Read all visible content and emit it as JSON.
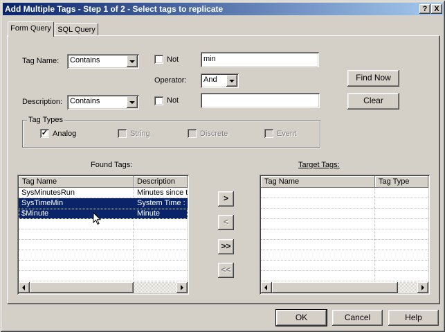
{
  "window": {
    "title": "Add Multiple Tags - Step 1 of 2 - Select tags to replicate",
    "help_label": "?",
    "close_label": "X"
  },
  "tabs": [
    {
      "label": "Form Query"
    },
    {
      "label": "SQL Query"
    }
  ],
  "form": {
    "tag_name_label": "Tag Name:",
    "tag_name_mode": "Contains",
    "not_label": "Not",
    "tag_name_value": "min",
    "operator_label": "Operator:",
    "operator_value": "And",
    "description_label": "Description:",
    "description_mode": "Contains",
    "description_value": "",
    "find_now_label": "Find Now",
    "clear_label": "Clear"
  },
  "tag_types": {
    "label": "Tag Types",
    "analog": {
      "label": "Analog",
      "checked": true
    },
    "string": {
      "label": "String",
      "checked": false
    },
    "discrete": {
      "label": "Discrete",
      "checked": false
    },
    "event": {
      "label": "Event",
      "checked": false
    },
    "check_mark": "✓"
  },
  "found_tags": {
    "label": "Found Tags:",
    "columns": [
      "Tag Name",
      "Description"
    ],
    "rows": [
      {
        "name": "SysMinutesRun",
        "desc": "Minutes since the",
        "selected": false
      },
      {
        "name": "SysTimeMin",
        "desc": "System Time : Min",
        "selected": true
      },
      {
        "name": "$Minute",
        "desc": "Minute",
        "selected": true
      }
    ]
  },
  "target_tags": {
    "label": "Target Tags:",
    "columns": [
      "Tag Name",
      "Tag Type"
    ],
    "rows": []
  },
  "move_buttons": {
    "add": ">",
    "remove": "<",
    "add_all": ">>",
    "remove_all": "<<"
  },
  "footer": {
    "ok": "OK",
    "cancel": "Cancel",
    "help": "Help"
  }
}
